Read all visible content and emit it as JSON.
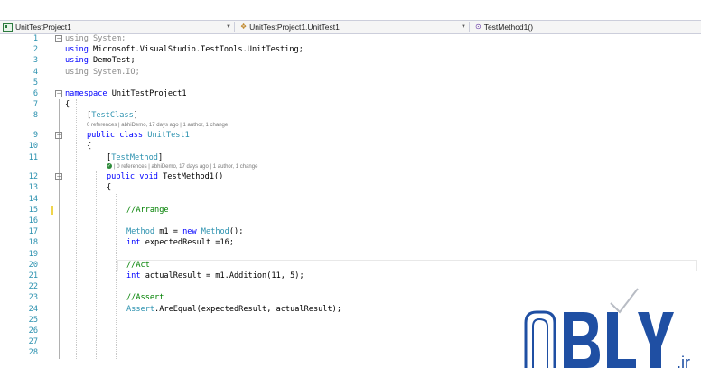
{
  "navbar": {
    "project": "UnitTestProject1",
    "class": "UnitTestProject1.UnitTest1",
    "method": "TestMethod1()"
  },
  "lines": [
    {
      "n": "1",
      "indent": 0,
      "fold": "minus",
      "tokens": [
        [
          "dim",
          "using System;"
        ]
      ]
    },
    {
      "n": "2",
      "indent": 0,
      "tokens": [
        [
          "kw",
          "using "
        ],
        [
          "",
          "Microsoft.VisualStudio.TestTools.UnitTesting;"
        ]
      ]
    },
    {
      "n": "3",
      "indent": 0,
      "tokens": [
        [
          "kw",
          "using "
        ],
        [
          "",
          "DemoTest;"
        ]
      ]
    },
    {
      "n": "4",
      "indent": 0,
      "tokens": [
        [
          "dim",
          "using System.IO;"
        ]
      ]
    },
    {
      "n": "5",
      "indent": 0,
      "tokens": []
    },
    {
      "n": "6",
      "indent": 0,
      "fold": "minus",
      "tokens": [
        [
          "kw",
          "namespace "
        ],
        [
          "",
          "UnitTestProject1"
        ]
      ]
    },
    {
      "n": "7",
      "indent": 0,
      "tokens": [
        [
          "",
          "{"
        ]
      ]
    },
    {
      "n": "8",
      "indent": 1,
      "tokens": [
        [
          "",
          "["
        ],
        [
          "type",
          "TestClass"
        ],
        [
          "",
          "]"
        ]
      ],
      "lens": "0 references | abhiDemo, 17 days ago | 1 author, 1 change"
    },
    {
      "n": "9",
      "indent": 1,
      "fold": "minus",
      "tokens": [
        [
          "kw",
          "public class "
        ],
        [
          "type",
          "UnitTest1"
        ]
      ]
    },
    {
      "n": "10",
      "indent": 1,
      "tokens": [
        [
          "",
          "{"
        ]
      ]
    },
    {
      "n": "11",
      "indent": 2,
      "tokens": [
        [
          "",
          "["
        ],
        [
          "type",
          "TestMethod"
        ],
        [
          "",
          "]"
        ]
      ],
      "lens": "| 0 references | abhiDemo, 17 days ago | 1 author, 1 change",
      "lens_ok": true
    },
    {
      "n": "12",
      "indent": 2,
      "fold": "minus",
      "tokens": [
        [
          "kw",
          "public void "
        ],
        [
          "",
          "TestMethod1()"
        ]
      ]
    },
    {
      "n": "13",
      "indent": 2,
      "tokens": [
        [
          "",
          "{"
        ]
      ]
    },
    {
      "n": "14",
      "indent": 3,
      "tokens": []
    },
    {
      "n": "15",
      "indent": 3,
      "tokens": [
        [
          "cm",
          "//Arrange"
        ]
      ],
      "marker": true
    },
    {
      "n": "16",
      "indent": 3,
      "tokens": []
    },
    {
      "n": "17",
      "indent": 3,
      "tokens": [
        [
          "type",
          "Method "
        ],
        [
          "",
          "m1 = "
        ],
        [
          "kw",
          "new "
        ],
        [
          "type",
          "Method"
        ],
        [
          "",
          "();"
        ]
      ]
    },
    {
      "n": "18",
      "indent": 3,
      "tokens": [
        [
          "kw",
          "int "
        ],
        [
          "",
          "expectedResult =16;"
        ]
      ]
    },
    {
      "n": "19",
      "indent": 3,
      "tokens": []
    },
    {
      "n": "20",
      "indent": 3,
      "tokens": [
        [
          "cm",
          "//Act"
        ]
      ],
      "current": true
    },
    {
      "n": "21",
      "indent": 3,
      "tokens": [
        [
          "kw",
          "int "
        ],
        [
          "",
          "actualResult = m1.Addition(11, 5);"
        ]
      ]
    },
    {
      "n": "22",
      "indent": 3,
      "tokens": []
    },
    {
      "n": "23",
      "indent": 3,
      "tokens": [
        [
          "cm",
          "//Assert"
        ]
      ]
    },
    {
      "n": "24",
      "indent": 3,
      "tokens": [
        [
          "type",
          "Assert"
        ],
        [
          "",
          ".AreEqual(expectedResult, actualResult);"
        ]
      ]
    },
    {
      "n": "25",
      "indent": 3,
      "tokens": []
    },
    {
      "n": "26",
      "indent": 3,
      "tokens": []
    },
    {
      "n": "27",
      "indent": 3,
      "tokens": []
    },
    {
      "n": "28",
      "indent": 3,
      "tokens": []
    }
  ],
  "watermark": {
    "text": "ABLY",
    "suffix": ".ir",
    "color": "#1f4fa3"
  }
}
